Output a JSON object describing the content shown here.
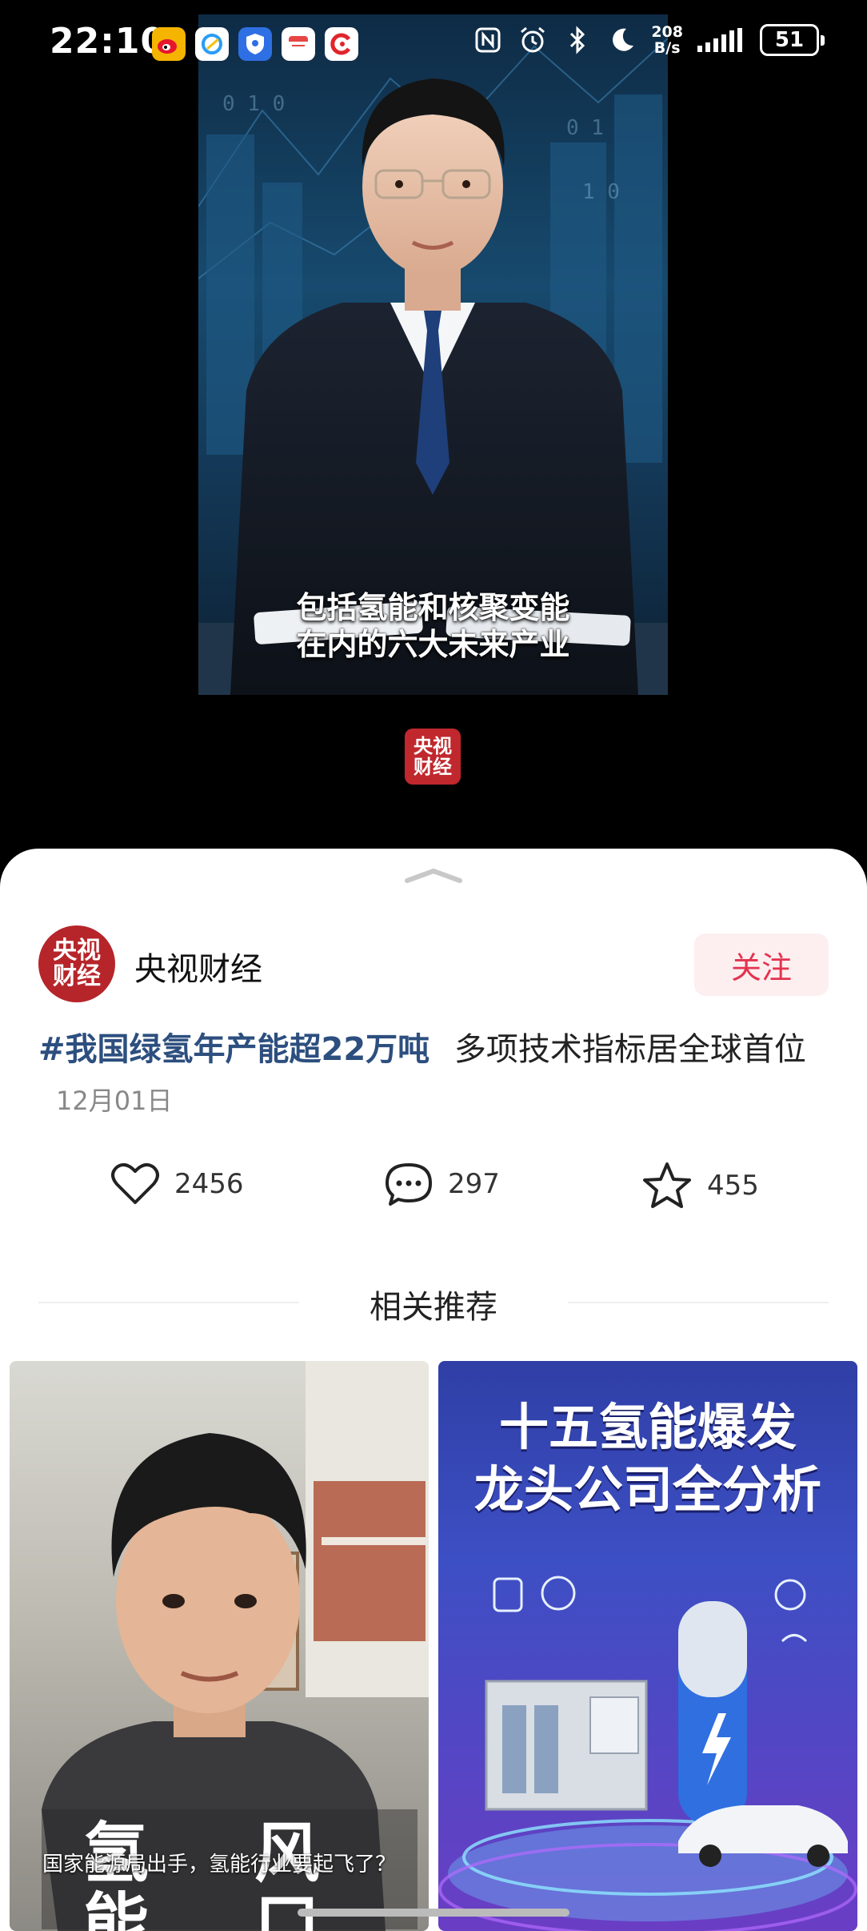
{
  "status_bar": {
    "time": "22:10",
    "net_speed_value": "208",
    "net_speed_unit": "B/s",
    "battery": "51"
  },
  "video": {
    "subtitle_line1": "包括氢能和核聚变能",
    "subtitle_line2": "在内的六大未来产业",
    "watermark": "央视\n财经"
  },
  "post": {
    "avatar_text": "央视\n财经",
    "author": "央视财经",
    "follow_label": "关注",
    "hashtag": "#我国绿氢年产能超22万吨",
    "title_rest": "多项技术指标居全球首位",
    "date": "12月01日",
    "likes": "2456",
    "comments": "297",
    "favorites": "455"
  },
  "related": {
    "title": "相关推荐",
    "card1": {
      "big_chars": [
        "氢",
        "风",
        "能",
        "口"
      ],
      "caption": "国家能源局出手，氢能行业要起飞了？"
    },
    "card2": {
      "line1": "十五氢能爆发",
      "line2": "龙头公司全分析"
    }
  },
  "colors": {
    "hashtag": "#2d4f7f",
    "follow_text": "#e3334f",
    "follow_bg": "#fdeff0",
    "brand_red": "#c0282d"
  }
}
